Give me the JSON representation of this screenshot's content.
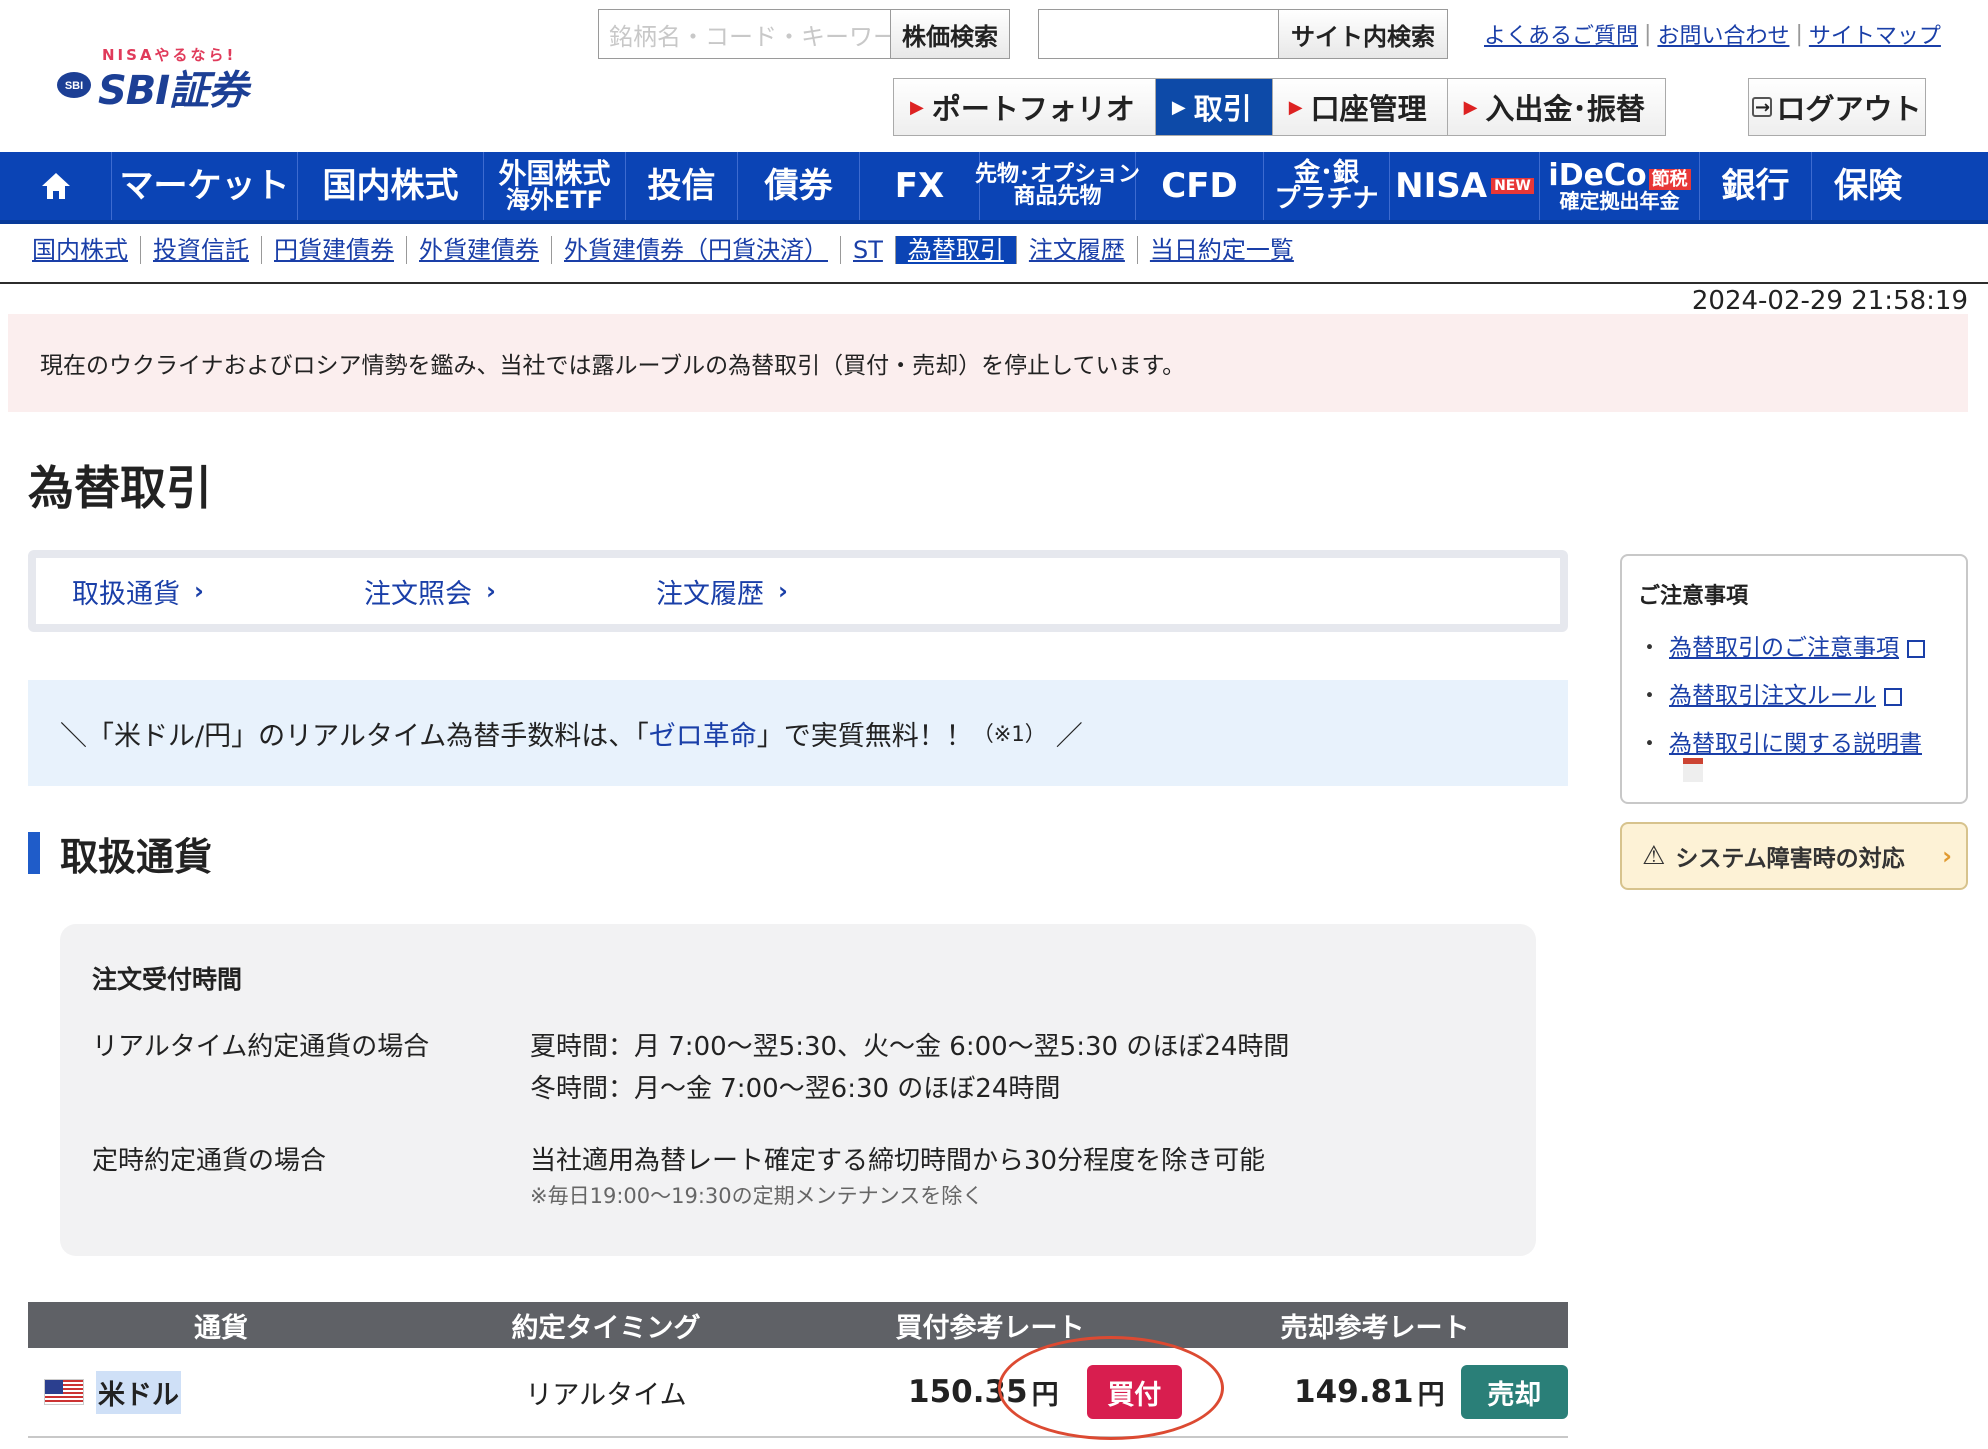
{
  "header": {
    "logo_tag": "NISAやるなら!",
    "logo_badge": "SBI",
    "logo_text": "SBI証券",
    "stock_search_placeholder": "銘柄名・コード・キーワード",
    "stock_search_button": "株価検索",
    "site_search_button": "サイト内検索",
    "links": [
      "よくあるご質問",
      "お問い合わせ",
      "サイトマップ"
    ],
    "tabs": [
      {
        "label": "ポートフォリオ",
        "active": false
      },
      {
        "label": "取引",
        "active": true
      },
      {
        "label": "口座管理",
        "active": false
      },
      {
        "label": "入出金･振替",
        "active": false
      }
    ],
    "logout": "ログアウト"
  },
  "main_nav": {
    "home_icon": "home-icon",
    "items": [
      {
        "label": "マーケット"
      },
      {
        "label": "国内株式"
      },
      {
        "line1": "外国株式",
        "line2": "海外ETF"
      },
      {
        "label": "投信"
      },
      {
        "label": "債券"
      },
      {
        "label": "FX"
      },
      {
        "line1": "先物･オプション",
        "line2": "商品先物"
      },
      {
        "label": "CFD"
      },
      {
        "line1": "金･銀",
        "line2": "プラチナ"
      },
      {
        "label": "NISA",
        "badge": "NEW"
      },
      {
        "line1": "iDeCo",
        "badge": "節税",
        "line2": "確定拠出年金"
      },
      {
        "label": "銀行"
      },
      {
        "label": "保険"
      }
    ]
  },
  "sub_nav": {
    "items": [
      "国内株式",
      "投資信託",
      "円貨建債券",
      "外貨建債券",
      "外貨建債券（円貨決済）",
      "ST",
      "為替取引",
      "注文履歴",
      "当日約定一覧"
    ],
    "active": "為替取引"
  },
  "timestamp": "2024-02-29 21:58:19",
  "notice": "現在のウクライナおよびロシア情勢を鑑み、当社では露ルーブルの為替取引（買付・売却）を停止しています。",
  "page_title": "為替取引",
  "subtabs": [
    "取扱通貨",
    "注文照会",
    "注文履歴"
  ],
  "promo": {
    "prefix": "＼「米ドル/円」のリアルタイム為替手数料は、「",
    "highlight": "ゼロ革命",
    "suffix": "」で実質無料！！",
    "note": "（※1）",
    "end": "／"
  },
  "section_title": "取扱通貨",
  "hours": {
    "heading": "注文受付時間",
    "rows": [
      {
        "label": "リアルタイム約定通貨の場合",
        "line1": "夏時間：月 7:00～翌5:30、火～金 6:00～翌5:30 のほぼ24時間",
        "line2": "冬時間：月～金 7:00～翌6:30 のほぼ24時間"
      },
      {
        "label": "定時約定通貨の場合",
        "line1": "当社適用為替レート確定する締切時間から30分程度を除き可能",
        "note": "※毎日19:00～19:30の定期メンテナンスを除く"
      }
    ]
  },
  "table": {
    "headers": [
      "通貨",
      "約定タイミング",
      "買付参考レート",
      "売却参考レート"
    ],
    "rows": [
      {
        "currency": "米ドル",
        "flag": "us-flag-icon",
        "timing": "リアルタイム",
        "buy_rate": "150.35",
        "buy_unit": "円",
        "buy_button": "買付",
        "sell_rate": "149.81",
        "sell_unit": "円",
        "sell_button": "売却"
      }
    ]
  },
  "sidebar": {
    "caution_title": "ご注意事項",
    "caution_links": [
      "為替取引のご注意事項",
      "為替取引注文ルール",
      "為替取引に関する説明書"
    ],
    "system_button": "システム障害時の対応"
  },
  "colors": {
    "nav_blue": "#0b44b5",
    "buy_red": "#d81e4f",
    "sell_teal": "#2a7f78",
    "notice_bg": "#fbeeee",
    "promo_bg": "#e8f2fc"
  }
}
